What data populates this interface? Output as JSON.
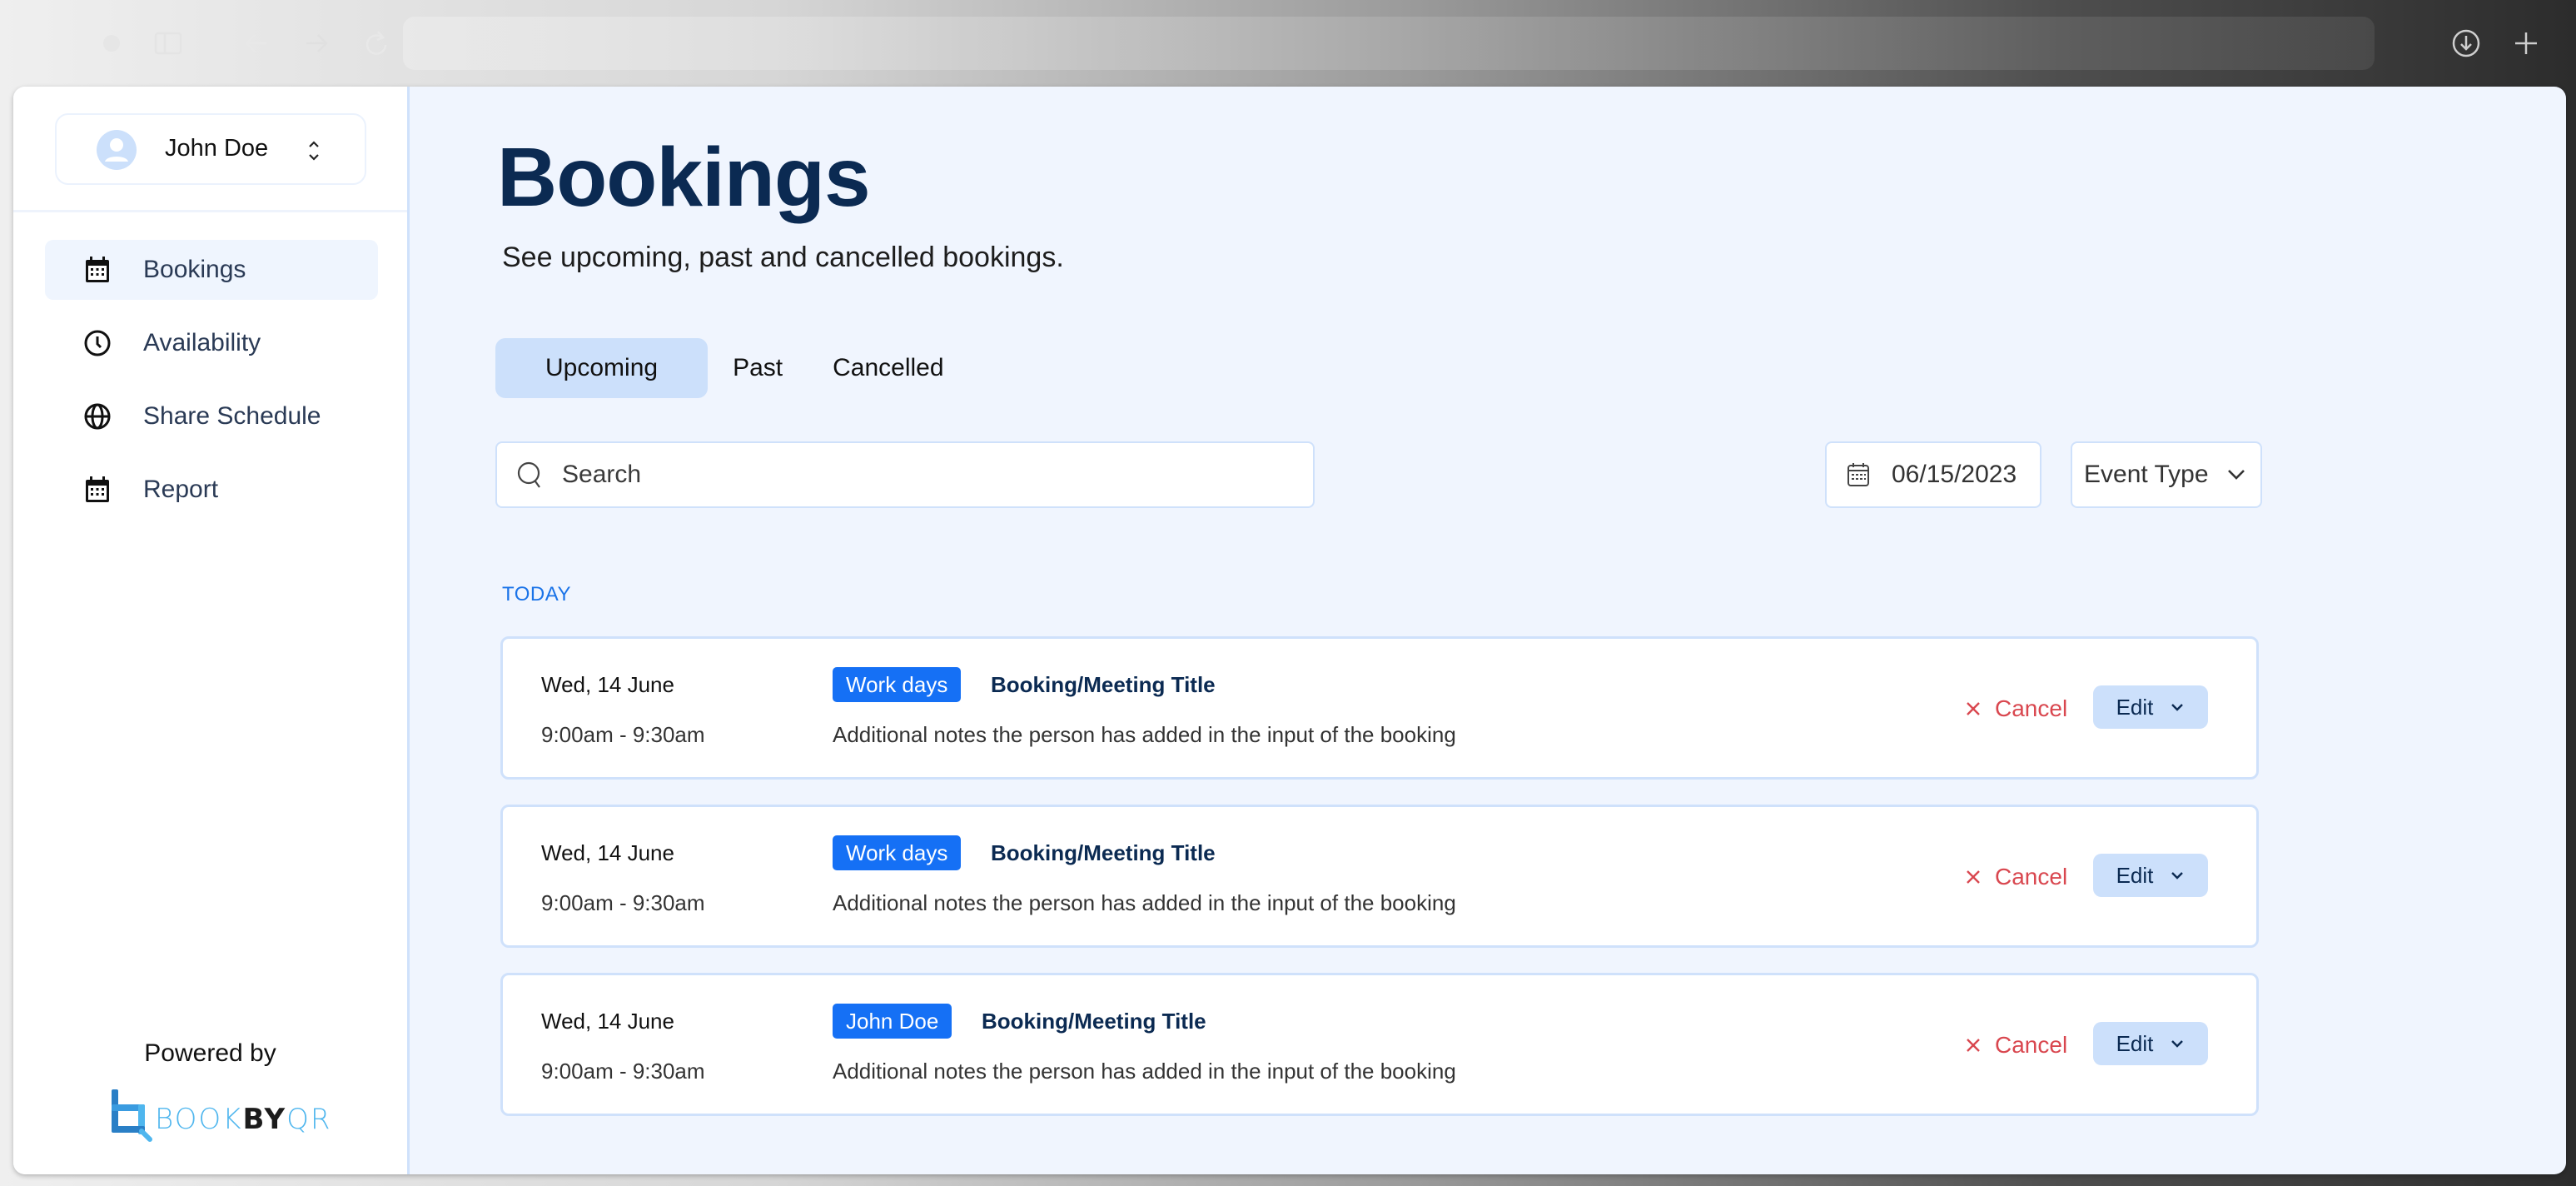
{
  "browser": {
    "address": "",
    "icons": [
      "sidebar-toggle-icon",
      "back-arrow-icon",
      "forward-arrow-icon",
      "reload-icon",
      "download-icon",
      "new-tab-plus-icon"
    ]
  },
  "user": {
    "name": "John Doe"
  },
  "sidebar": {
    "items": [
      {
        "label": "Bookings",
        "icon": "calendar-icon",
        "active": true
      },
      {
        "label": "Availability",
        "icon": "clock-icon",
        "active": false
      },
      {
        "label": "Share Schedule",
        "icon": "globe-icon",
        "active": false
      },
      {
        "label": "Report",
        "icon": "calendar-icon",
        "active": false
      }
    ],
    "powered_by": "Powered by",
    "logo": {
      "part1": "BOOK",
      "part2": "BY",
      "part3": "QR"
    }
  },
  "main": {
    "title": "Bookings",
    "subtitle": "See upcoming, past and cancelled bookings.",
    "tabs": [
      {
        "label": "Upcoming",
        "active": true
      },
      {
        "label": "Past",
        "active": false
      },
      {
        "label": "Cancelled",
        "active": false
      }
    ],
    "search": {
      "placeholder": "Search",
      "value": ""
    },
    "date_filter": "06/15/2023",
    "event_type": "Event Type",
    "section_label": "TODAY",
    "bookings": [
      {
        "date": "Wed, 14 June",
        "time": "9:00am - 9:30am",
        "badge": "Work days",
        "title": "Booking/Meeting Title",
        "notes": "Additional notes the person has added in the input of the booking",
        "cancel_label": "Cancel",
        "edit_label": "Edit"
      },
      {
        "date": "Wed, 14 June",
        "time": "9:00am - 9:30am",
        "badge": "Work days",
        "title": "Booking/Meeting Title",
        "notes": "Additional notes the person has added in the input of the booking",
        "cancel_label": "Cancel",
        "edit_label": "Edit"
      },
      {
        "date": "Wed, 14 June",
        "time": "9:00am - 9:30am",
        "badge": "John Doe",
        "title": "Booking/Meeting Title",
        "notes": "Additional notes the person has added in the input of the booking",
        "cancel_label": "Cancel",
        "edit_label": "Edit"
      }
    ]
  },
  "colors": {
    "primary": "#1570f5",
    "title_navy": "#0b2a52",
    "accent_light": "#cce0fb",
    "page_bg": "#f0f5fe",
    "danger": "#d9474f",
    "link_blue": "#1a73e8"
  }
}
